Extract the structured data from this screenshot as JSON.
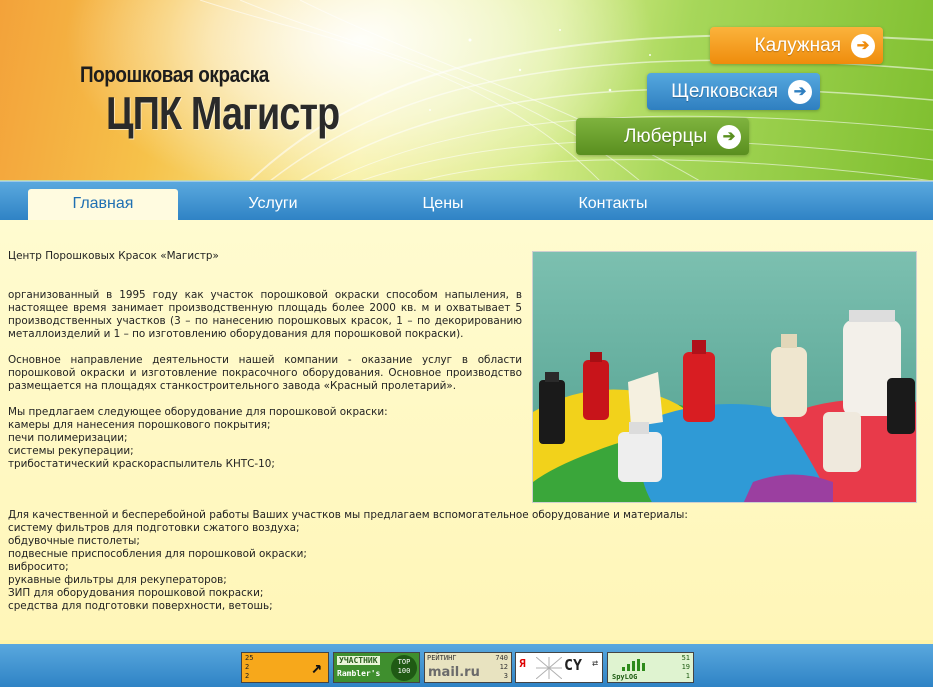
{
  "header": {
    "logo_small": "Порошковая окраска",
    "logo_big": "ЦПК Магистр",
    "locations": [
      {
        "label": "Калужная",
        "icon": "arrow-right-icon",
        "color": "#f09a1a"
      },
      {
        "label": "Щелковская",
        "icon": "arrow-right-icon",
        "color": "#3a8dcf"
      },
      {
        "label": "Люберцы",
        "icon": "arrow-right-icon",
        "color": "#6a9e2c"
      }
    ]
  },
  "nav": {
    "items": [
      {
        "label": "Главная",
        "active": true
      },
      {
        "label": "Услуги",
        "active": false
      },
      {
        "label": "Цены",
        "active": false
      },
      {
        "label": "Контакты",
        "active": false
      }
    ]
  },
  "content": {
    "heading": "Центр Порошковых Красок «Магистр»",
    "p1": "организованный в 1995 году как участок порошковой окраски способом напыления, в настоящее время занимает производственную площадь более 2000 кв. м и охватывает 5 производственных участков (3 – по нанесению порошковых красок, 1 – по декорированию металлоизделий и 1 – по изготовлению оборудования для порошковой покраски).",
    "p2": "Основное направление деятельности нашей компании - оказание услуг в области порошковой окраски и изготовление покрасочного оборудования. Основное производство размещается на площадях станкостроительного завода «Красный пролетарий».",
    "list1_intro": "Мы предлагаем следующее оборудование для порошковой окраски:",
    "list1": [
      "камеры для нанесения порошкового покрытия;",
      "печи полимеризации;",
      "системы рекуперации;",
      "трибостатический краскораспылитель КНТС-10;"
    ],
    "list2_intro": "Для качественной и бесперебойной работы Ваших участков мы предлагаем вспомогательное оборудование и материалы:",
    "list2": [
      "систему фильтров для подготовки сжатого воздуха;",
      "обдувочные пистолеты;",
      "подвесные приспособления для порошковой окраски;",
      "вибросито;",
      "рукавные фильтры для рекуператоров;",
      "ЗИП для оборудования порошковой покраски;",
      "средства для подготовки поверхности, ветошь;"
    ]
  },
  "footer": {
    "counters": [
      {
        "name": "liveinternet",
        "lines": [
          "25",
          "2",
          "2"
        ]
      },
      {
        "name": "rambler",
        "line1": "УЧАСТНИК",
        "line2": "Rambler's",
        "badge_top": "TOP",
        "badge_bottom": "100"
      },
      {
        "name": "mailru",
        "label": "РЕЙТИНГ",
        "brand": "mail.ru",
        "lines": [
          "740",
          "12",
          "3"
        ]
      },
      {
        "name": "yandex-cy",
        "ya": "Я",
        "cy": "CY"
      },
      {
        "name": "spylog",
        "brand": "SpyLOG",
        "lines": [
          "51",
          "19",
          "1"
        ]
      }
    ]
  }
}
